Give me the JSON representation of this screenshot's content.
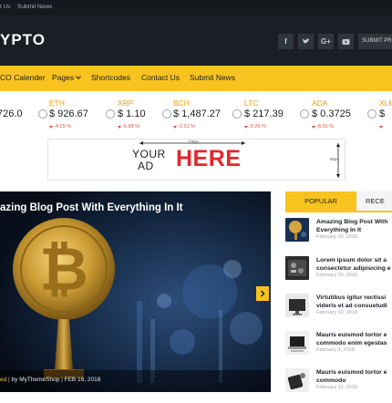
{
  "topbar": {
    "links": [
      "t Us",
      "Submit News"
    ]
  },
  "header": {
    "logo": "YPTO",
    "social": [
      "f",
      "t",
      "G+",
      "yt"
    ],
    "submit_label": "SUBMIT PRE"
  },
  "nav": {
    "items": [
      "CO Calender",
      "Pages",
      "Shortcodes",
      "Contact Us",
      "Submit News"
    ]
  },
  "ticker": [
    {
      "symbol": "",
      "price": "726.0",
      "change": ""
    },
    {
      "symbol": "ETH",
      "price": "$ 926.67",
      "change": "-4.15 %"
    },
    {
      "symbol": "XRP",
      "price": "$ 1.10",
      "change": "-5.98 %"
    },
    {
      "symbol": "BCH",
      "price": "$ 1,487.27",
      "change": "-2.31 %"
    },
    {
      "symbol": "LTC",
      "price": "$ 217.39",
      "change": "-5.29 %"
    },
    {
      "symbol": "ADA",
      "price": "$ 0.3725",
      "change": "-8.31 %"
    },
    {
      "symbol": "XLM",
      "price": "$",
      "change": ""
    }
  ],
  "ad": {
    "your": "YOUR",
    "ad": "AD",
    "here": "HERE",
    "width_label": "728px",
    "height_label": "90px"
  },
  "hero": {
    "title": "azing Blog Post With Everything In It",
    "category": "ed",
    "author": "by MyThemeShop",
    "date": "FEB 16, 2018"
  },
  "sidebar": {
    "tab_popular": "POPULAR",
    "tab_recent": "RECE",
    "posts": [
      {
        "title": "Amazing Blog Post With Everything In It",
        "date": "February 16, 2018"
      },
      {
        "title": "Lorem ipsum dolor sit a consectetur adipisicing e",
        "date": "February 16, 2018"
      },
      {
        "title": "Virtutibus igitur rectissi videris et ad consuetudi",
        "date": "February 10, 2018"
      },
      {
        "title": "Mauris euismod tortor e commodo enim egestas",
        "date": "February 9, 2018"
      },
      {
        "title": "Mauris euismod tortor e commodo",
        "date": "February 12, 2018"
      }
    ]
  },
  "colors": {
    "accent": "#f8c31f",
    "dark": "#1b1f25",
    "negative": "#e74c3c",
    "symbol": "#f39c12",
    "ad_red": "#e3262d"
  }
}
